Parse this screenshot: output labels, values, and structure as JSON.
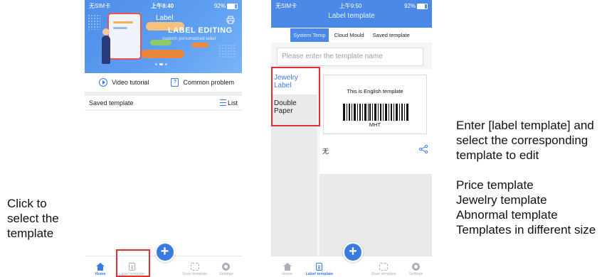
{
  "annotations": {
    "left": "Click to select the template",
    "right": [
      "Enter [label template] and select the corresponding template to edit",
      "Price template",
      "Jewelry template",
      "Abnormal template",
      "Templates in different size"
    ]
  },
  "phone1": {
    "status": {
      "carrier": "无SIM卡",
      "time": "上午8:40",
      "battery": "92%"
    },
    "banner": {
      "label": "Label",
      "title": "LABEL EDITING",
      "subtitle": "custom personalized label"
    },
    "shortcuts": {
      "video": "Video tutorial",
      "problem": "Common problem"
    },
    "saved": {
      "title": "Saved template",
      "list": "List"
    },
    "tabs": [
      "Home",
      "Label template",
      "",
      "Scan template",
      "Settings"
    ]
  },
  "phone2": {
    "status": {
      "carrier": "无SIM卡",
      "time": "上午9:50",
      "battery": "92%"
    },
    "title": "Label template",
    "tabs": [
      "System Temp",
      "Cloud Mould",
      "Saved template"
    ],
    "search_placeholder": "Please enter the template name",
    "side": [
      "Jewelry Label",
      "Double Paper"
    ],
    "template": {
      "text": "This is English template",
      "code": "MHT",
      "name": "无"
    },
    "tabbar": [
      "Home",
      "Label template",
      "",
      "Scan template",
      "Settings"
    ]
  },
  "colors": {
    "accent": "#3b7be0",
    "highlight": "#e53030",
    "header": "#4a89e8"
  }
}
